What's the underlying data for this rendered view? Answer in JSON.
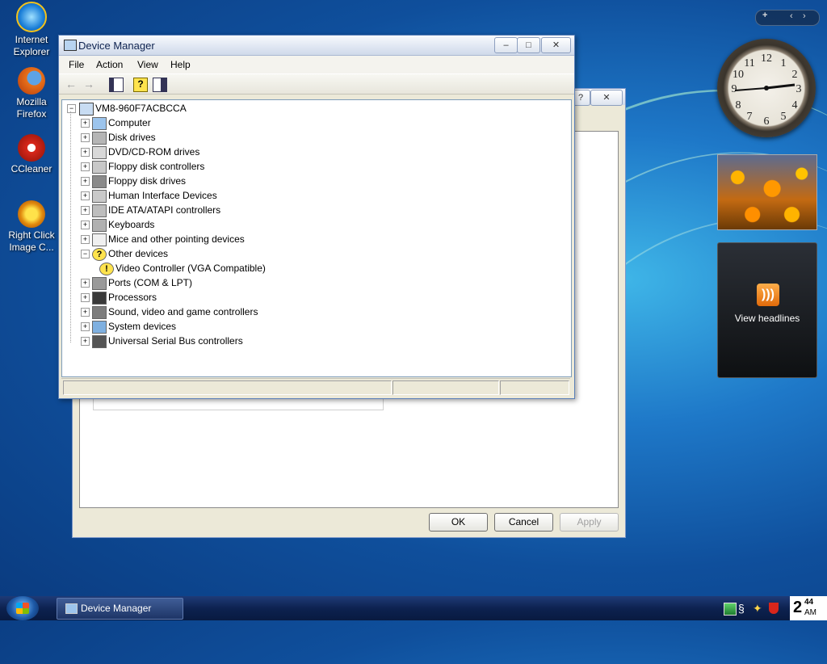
{
  "desktop": {
    "icons": [
      {
        "label_line1": "Internet",
        "label_line2": "Explorer",
        "icon": "internet-explorer-icon"
      },
      {
        "label_line1": "Mozilla",
        "label_line2": "Firefox",
        "icon": "firefox-icon"
      },
      {
        "label_line1": "CCleaner",
        "label_line2": "",
        "icon": "ccleaner-icon"
      },
      {
        "label_line1": "Right Click",
        "label_line2": "Image C...",
        "icon": "right-click-image-icon"
      }
    ]
  },
  "sidebar": {
    "add_button": "+",
    "clock_numbers": [
      "12",
      "1",
      "2",
      "3",
      "4",
      "5",
      "6",
      "7",
      "8",
      "9",
      "10",
      "11"
    ],
    "feed_label": "View headlines"
  },
  "back_dialog": {
    "ok": "OK",
    "cancel": "Cancel",
    "apply": "Apply",
    "help_button": "?",
    "close_button": "✕"
  },
  "device_manager": {
    "title": "Device Manager",
    "caption": {
      "minimize": "–",
      "maximize": "□",
      "close": "✕"
    },
    "menu": [
      "File",
      "Action",
      "View",
      "Help"
    ],
    "root": "VM8-960F7ACBCCA",
    "tree": [
      {
        "label": "Computer",
        "icon": "computer-icon",
        "expander": "+"
      },
      {
        "label": "Disk drives",
        "icon": "disk-drive-icon",
        "expander": "+"
      },
      {
        "label": "DVD/CD-ROM drives",
        "icon": "cdrom-icon",
        "expander": "+"
      },
      {
        "label": "Floppy disk controllers",
        "icon": "floppy-controller-icon",
        "expander": "+"
      },
      {
        "label": "Floppy disk drives",
        "icon": "floppy-drive-icon",
        "expander": "+"
      },
      {
        "label": "Human Interface Devices",
        "icon": "hid-icon",
        "expander": "+"
      },
      {
        "label": "IDE ATA/ATAPI controllers",
        "icon": "ide-controller-icon",
        "expander": "+"
      },
      {
        "label": "Keyboards",
        "icon": "keyboard-icon",
        "expander": "+"
      },
      {
        "label": "Mice and other pointing devices",
        "icon": "mouse-icon",
        "expander": "+"
      },
      {
        "label": "Other devices",
        "icon": "unknown-device-icon",
        "expander": "−"
      },
      {
        "label": "Video Controller (VGA Compatible)",
        "icon": "warning-device-icon",
        "expander": "",
        "child": true
      },
      {
        "label": "Ports (COM & LPT)",
        "icon": "port-icon",
        "expander": "+"
      },
      {
        "label": "Processors",
        "icon": "processor-icon",
        "expander": "+"
      },
      {
        "label": "Sound, video and game controllers",
        "icon": "sound-icon",
        "expander": "+"
      },
      {
        "label": "System devices",
        "icon": "system-device-icon",
        "expander": "+"
      },
      {
        "label": "Universal Serial Bus controllers",
        "icon": "usb-icon",
        "expander": "+"
      }
    ]
  },
  "taskbar": {
    "task_label": "Device Manager",
    "clock_hour": "2",
    "clock_minutes": "44",
    "clock_ampm": "AM"
  },
  "colors": {
    "accent": "#0a3a7e",
    "title_text": "#0e2350"
  }
}
